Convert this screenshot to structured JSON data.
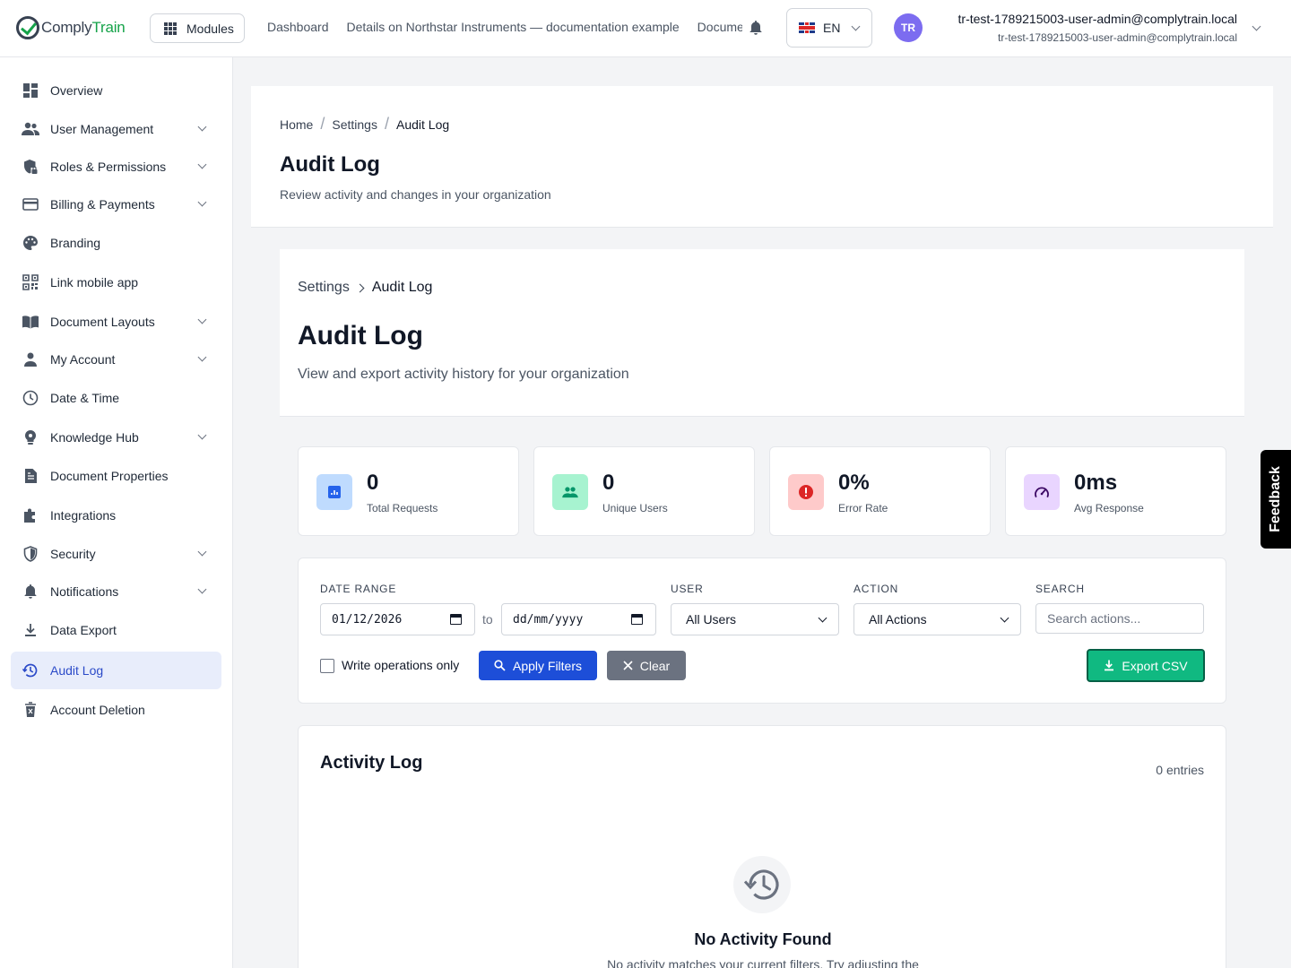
{
  "brand": {
    "name_part1": "Comply",
    "name_part2": "Train"
  },
  "topbar": {
    "modules_label": "Modules",
    "nav": [
      "Dashboard",
      "Details on Northstar Instruments — documentation example",
      "Documents"
    ],
    "language": "EN",
    "avatar_initials": "TR",
    "user_name": "tr-test-1789215003-user-admin@complytrain.local",
    "user_email": "tr-test-1789215003-user-admin@complytrain.local"
  },
  "sidebar": {
    "items": [
      {
        "label": "Overview",
        "icon": "dashboard-icon"
      },
      {
        "label": "User Management",
        "icon": "users-icon"
      },
      {
        "label": "Roles & Permissions",
        "icon": "shield-lock-icon"
      },
      {
        "label": "Billing & Payments",
        "icon": "credit-card-icon"
      },
      {
        "label": "Branding",
        "icon": "palette-icon"
      },
      {
        "label": "Link mobile app",
        "icon": "qr-code-icon"
      },
      {
        "label": "Document Layouts",
        "icon": "book-icon"
      },
      {
        "label": "My Account",
        "icon": "person-icon"
      },
      {
        "label": "Date & Time",
        "icon": "clock-icon"
      },
      {
        "label": "Knowledge Hub",
        "icon": "lightbulb-icon"
      },
      {
        "label": "Document Properties",
        "icon": "document-icon"
      },
      {
        "label": "Integrations",
        "icon": "puzzle-icon"
      },
      {
        "label": "Security",
        "icon": "shield-icon"
      },
      {
        "label": "Notifications",
        "icon": "bell-icon"
      },
      {
        "label": "Data Export",
        "icon": "download-icon"
      },
      {
        "label": "Audit Log",
        "icon": "history-icon"
      },
      {
        "label": "Account Deletion",
        "icon": "trash-icon"
      }
    ]
  },
  "page_header": {
    "breadcrumb": [
      "Home",
      "Settings",
      "Audit Log"
    ],
    "title": "Audit Log",
    "subtitle": "Review activity and changes in your organization"
  },
  "panel": {
    "breadcrumb": [
      "Settings",
      "Audit Log"
    ],
    "title": "Audit Log",
    "subtitle": "View and export activity history for your organization"
  },
  "stats": [
    {
      "value": "0",
      "label": "Total Requests",
      "icon": "chart-icon",
      "color": "#2563eb"
    },
    {
      "value": "0",
      "label": "Unique Users",
      "icon": "users-icon",
      "color": "#059669"
    },
    {
      "value": "0%",
      "label": "Error Rate",
      "icon": "alert-icon",
      "color": "#dc2626"
    },
    {
      "value": "0ms",
      "label": "Avg Response",
      "icon": "speedometer-icon",
      "color": "#6b21a8"
    }
  ],
  "filters": {
    "date_range_label": "DATE RANGE",
    "date_from": "01/12/2026",
    "date_to_placeholder": "dd/mm/yyyy",
    "to_label": "to",
    "user_label": "USER",
    "user_value": "All Users",
    "action_label": "ACTION",
    "action_value": "All Actions",
    "search_label": "SEARCH",
    "search_placeholder": "Search actions...",
    "write_only_label": "Write operations only",
    "apply_label": "Apply Filters",
    "clear_label": "Clear",
    "export_label": "Export CSV"
  },
  "activity": {
    "title": "Activity Log",
    "count": "0 entries",
    "empty_title": "No Activity Found",
    "empty_subtitle": "No activity matches your current filters. Try adjusting the"
  },
  "feedback_label": "Feedback"
}
